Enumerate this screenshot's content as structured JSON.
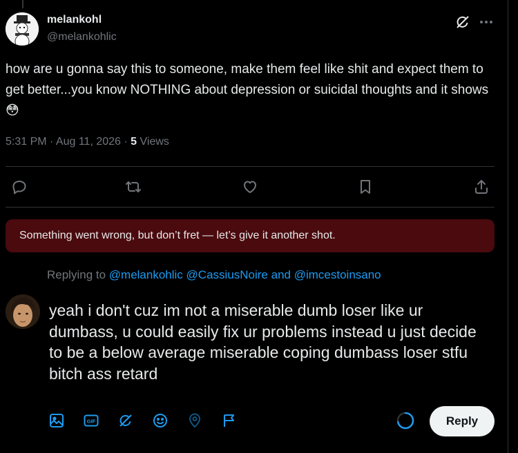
{
  "tweet": {
    "author_name": "melankohl",
    "author_handle": "@melankohlic",
    "text": "how are u gonna say this to someone, make them feel like shit and expect them to get better...you know NOTHING about depression or suicidal thoughts and it shows 😳",
    "timestamp": "5:31 PM · Aug 11, 2026 · ",
    "views_count": "5",
    "views_label": " Views"
  },
  "icons": {
    "grok": "grok-icon",
    "more": "more-icon",
    "reply": "reply-icon",
    "retweet": "retweet-icon",
    "like": "like-icon",
    "bookmark": "bookmark-icon",
    "share": "share-icon"
  },
  "error_banner": {
    "text": "Something went wrong, but don’t fret — let’s give it another shot."
  },
  "composer": {
    "replying_prefix": "Replying to ",
    "mention_1": "@melankohlic",
    "mention_2": "@CassiusNoire",
    "and_text": " and ",
    "mention_3": "@imcestoinsano",
    "draft_text": "yeah i don't cuz im not a miserable dumb loser like ur dumbass, u could easily fix ur problems instead u just decide to be a below average miserable coping dumbass loser stfu bitch ass retard",
    "gif_label": "GIF",
    "reply_button": "Reply"
  },
  "colors": {
    "accent": "#1d9bf0",
    "error_bg": "#4a0a0e",
    "muted": "#71767b"
  }
}
